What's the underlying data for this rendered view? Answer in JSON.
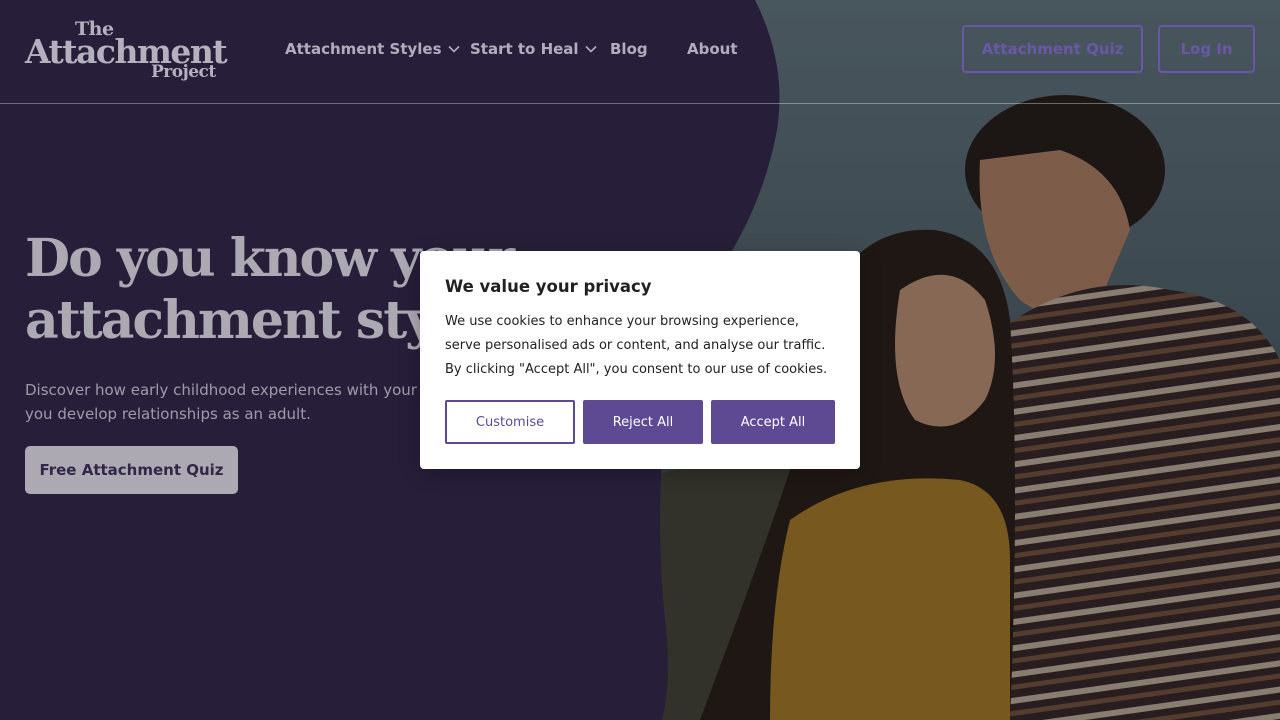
{
  "brand": {
    "logo_line1": "The",
    "logo_line2": "Attachment",
    "logo_line3": "Project"
  },
  "nav": {
    "items": [
      {
        "label": "Attachment Styles",
        "has_dropdown": true
      },
      {
        "label": "Start to Heal",
        "has_dropdown": true
      },
      {
        "label": "Blog",
        "has_dropdown": false
      },
      {
        "label": "About",
        "has_dropdown": false
      }
    ],
    "quiz_button": "Attachment Quiz",
    "login_button": "Log In"
  },
  "hero": {
    "title": "Do you know your attachment style?",
    "subtitle": "Discover how early childhood experiences with your parents shape how you develop relationships as an adult.",
    "cta": "Free Attachment Quiz",
    "image_icon": "couple-photo"
  },
  "cookie_modal": {
    "title": "We value your privacy",
    "body": "We use cookies to enhance your browsing experience, serve personalised ads or content, and analyse our traffic. By clicking \"Accept All\", you consent to our use of cookies.",
    "customise": "Customise",
    "reject": "Reject All",
    "accept": "Accept All"
  },
  "colors": {
    "brand_purple": "#3a2d55",
    "accent_purple": "#5e4a93",
    "button_outline": "#6a57a6"
  }
}
